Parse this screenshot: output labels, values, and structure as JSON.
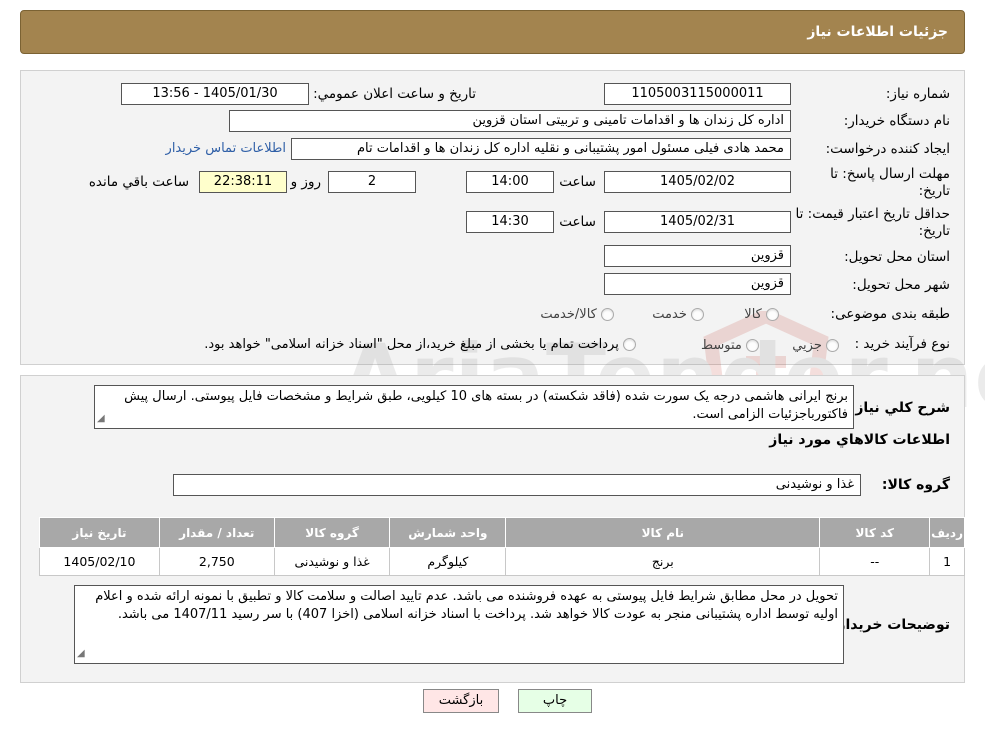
{
  "page": {
    "title": "جزئیات اطلاعات نیاز"
  },
  "watermark": "AriaTender.neT",
  "form": {
    "need_number_label": "شماره نیاز:",
    "need_number": "1105003115000011",
    "announce_label": "تاریخ و ساعت اعلان عمومي:",
    "announce_value": "1405/01/30 - 13:56",
    "buyer_org_label": "نام دستگاه خریدار:",
    "buyer_org": "اداره کل زندان ها و اقدامات تامینی و تربیتی استان قزوین",
    "requester_label": "ایجاد کننده درخواست:",
    "requester": "محمد هادی فیلی مسئول امور پشتیبانی و نقلیه اداره کل زندان ها و اقدامات تام",
    "contact_link": "اطلاعات تماس خریدار",
    "deadline_label": "مهلت ارسال پاسخ: تا تاریخ:",
    "deadline_date": "1405/02/02",
    "time_label": "ساعت",
    "deadline_time": "14:00",
    "days_value": "2",
    "days_label": "روز و",
    "remaining_value": "22:38:11",
    "remaining_label": "ساعت باقي مانده",
    "validity_label": "حداقل تاریخ اعتبار قیمت: تا تاریخ:",
    "validity_date": "1405/02/31",
    "validity_time": "14:30",
    "province_label": "استان محل تحویل:",
    "province": "قزوین",
    "city_label": "شهر محل تحویل:",
    "city": "قزوین",
    "category_label": "طبقه بندی موضوعی:",
    "category_options": [
      "کالا",
      "خدمت",
      "کالا/خدمت"
    ],
    "process_label": "نوع فرآیند خرید :",
    "process_options": [
      "جزیي",
      "متوسط"
    ],
    "process_note": "پرداخت تمام یا بخشی از مبلغ خرید،از محل \"اسناد خزانه اسلامی\" خواهد بود."
  },
  "details": {
    "description_label": "شرح کلي نیاز:",
    "description": "برنج ایرانی هاشمی درجه یک سورت شده (فاقد شکسته) در بسته های 10 کیلویی، طبق شرایط و مشخصات فایل پیوستی. ارسال پیش فاکتورباجزئیات الزامی است.",
    "goods_info_title": "اطلاعات کالاهاي مورد نیاز",
    "goods_group_label": "گروه کالا:",
    "goods_group": "غذا و نوشیدنی",
    "table": {
      "headers": [
        "ردیف",
        "کد کالا",
        "نام کالا",
        "واحد شمارش",
        "گروه کالا",
        "تعداد / مقدار",
        "تاریخ نیاز"
      ],
      "rows": [
        [
          "1",
          "--",
          "برنج",
          "کیلوگرم",
          "غذا و نوشیدنی",
          "2,750",
          "1405/02/10"
        ]
      ]
    },
    "buyer_notes_label": "توضیحات خریدار:",
    "buyer_notes": "تحویل در محل مطابق شرایط فایل پیوستی به عهده فروشنده می باشد. عدم تایید اصالت و سلامت کالا و تطبیق با نمونه ارائه شده و اعلام اولیه توسط اداره پشتیبانی منجر به عودت کالا خواهد شد. پرداخت با اسناد خزانه اسلامی (اخزا 407) با سر رسید 1407/11 می باشد."
  },
  "buttons": {
    "print": "چاپ",
    "back": "بازگشت"
  },
  "colors": {
    "header_bg": "#a3844f",
    "panel_bg": "#f3f3f3",
    "table_header_bg": "#a8a8a8",
    "timer_bg": "#ffffcc",
    "print_btn_bg": "#e6ffe6",
    "back_btn_bg": "#ffe6e6",
    "link": "#2f5fa7"
  }
}
